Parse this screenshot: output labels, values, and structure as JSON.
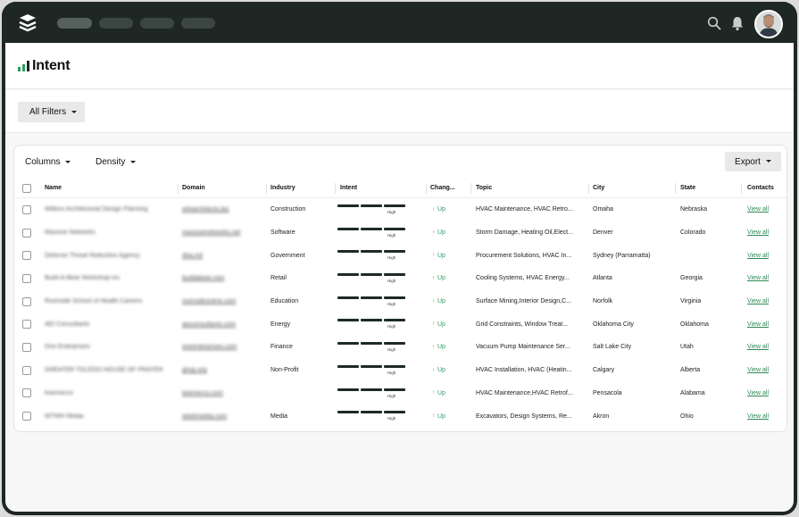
{
  "nav": {
    "pills": [
      "",
      "",
      "",
      ""
    ]
  },
  "page": {
    "title": "Intent"
  },
  "filters": {
    "all_filters_label": "All Filters"
  },
  "toolbar": {
    "columns_label": "Columns",
    "density_label": "Density",
    "export_label": "Export"
  },
  "table": {
    "headers": [
      "Name",
      "Domain",
      "Industry",
      "Intent",
      "Chang...",
      "Topic",
      "City",
      "State",
      "Contacts"
    ],
    "rows": [
      {
        "name": "Wilkins Architectural Design Planning",
        "domain": "wilsarchitects.biz",
        "industry": "Construction",
        "intent": "High",
        "change": "Up",
        "topic": "HVAC Maintenance, HVAC Retro...",
        "city": "Omaha",
        "state": "Nebraska",
        "contacts": "View all"
      },
      {
        "name": "Massive Networks",
        "domain": "massivenetworks.net",
        "industry": "Software",
        "intent": "High",
        "change": "Up",
        "topic": "Storm Damage, Heating Oil,Elect...",
        "city": "Denver",
        "state": "Colorado",
        "contacts": "View all"
      },
      {
        "name": "Defense Threat Reduction Agency",
        "domain": "dtra.mil",
        "industry": "Government",
        "intent": "High",
        "change": "Up",
        "topic": "Procurement Solutions, HVAC In...",
        "city": "Sydney (Parramatta)",
        "state": "",
        "contacts": "View all"
      },
      {
        "name": "Build-A-Bear Workshop Inc",
        "domain": "buildabear.com",
        "industry": "Retail",
        "intent": "High",
        "change": "Up",
        "topic": "Cooling Systems, HVAC Energy...",
        "city": "Atlanta",
        "state": "Georgia",
        "contacts": "View all"
      },
      {
        "name": "Riverside School of Health Careers",
        "domain": "riversideonline.com",
        "industry": "Education",
        "intent": "High",
        "change": "Up",
        "topic": "Surface Mining,Interior Design,C...",
        "city": "Norfolk",
        "state": "Virginia",
        "contacts": "View all"
      },
      {
        "name": "AEI Consultants",
        "domain": "aeiconsultants.com",
        "industry": "Energy",
        "intent": "High",
        "change": "Up",
        "topic": "Grid Constraints, Window Treat...",
        "city": "Oklahoma City",
        "state": "Oklahoma",
        "contacts": "View all"
      },
      {
        "name": "One Enterprises",
        "domain": "oneenterprises.com",
        "industry": "Finance",
        "intent": "High",
        "change": "Up",
        "topic": "Vacuum Pump Maintenance Ser...",
        "city": "Salt Lake City",
        "state": "Utah",
        "contacts": "View all"
      },
      {
        "name": "GREATER TOLEDO HOUSE OF PRAYER",
        "domain": "ghop.org",
        "industry": "Non-Profit",
        "intent": "High",
        "change": "Up",
        "topic": "HVAC Installation, HVAC (Heatin...",
        "city": "Calgary",
        "state": "Alberta",
        "contacts": "View all"
      },
      {
        "name": "Keemerco",
        "domain": "keemerco.com",
        "industry": "",
        "intent": "High",
        "change": "Up",
        "topic": "HVAC Maintenance,HVAC Retrof...",
        "city": "Pensacola",
        "state": "Alabama",
        "contacts": "View all"
      },
      {
        "name": "WTWH Media",
        "domain": "wtwhmedia.com",
        "industry": "Media",
        "intent": "High",
        "change": "Up",
        "topic": "Excavators, Design Systems, Re...",
        "city": "Akron",
        "state": "Ohio",
        "contacts": "View all"
      }
    ]
  },
  "colors": {
    "nav_bg": "#1e2723",
    "accent_green": "#2e9a63",
    "intent_bar": "#1d2a25"
  },
  "icons": {
    "logo": "stacked-layers-icon",
    "search": "search-icon",
    "notifications": "bell-icon",
    "title": "bar-chart-icon"
  }
}
